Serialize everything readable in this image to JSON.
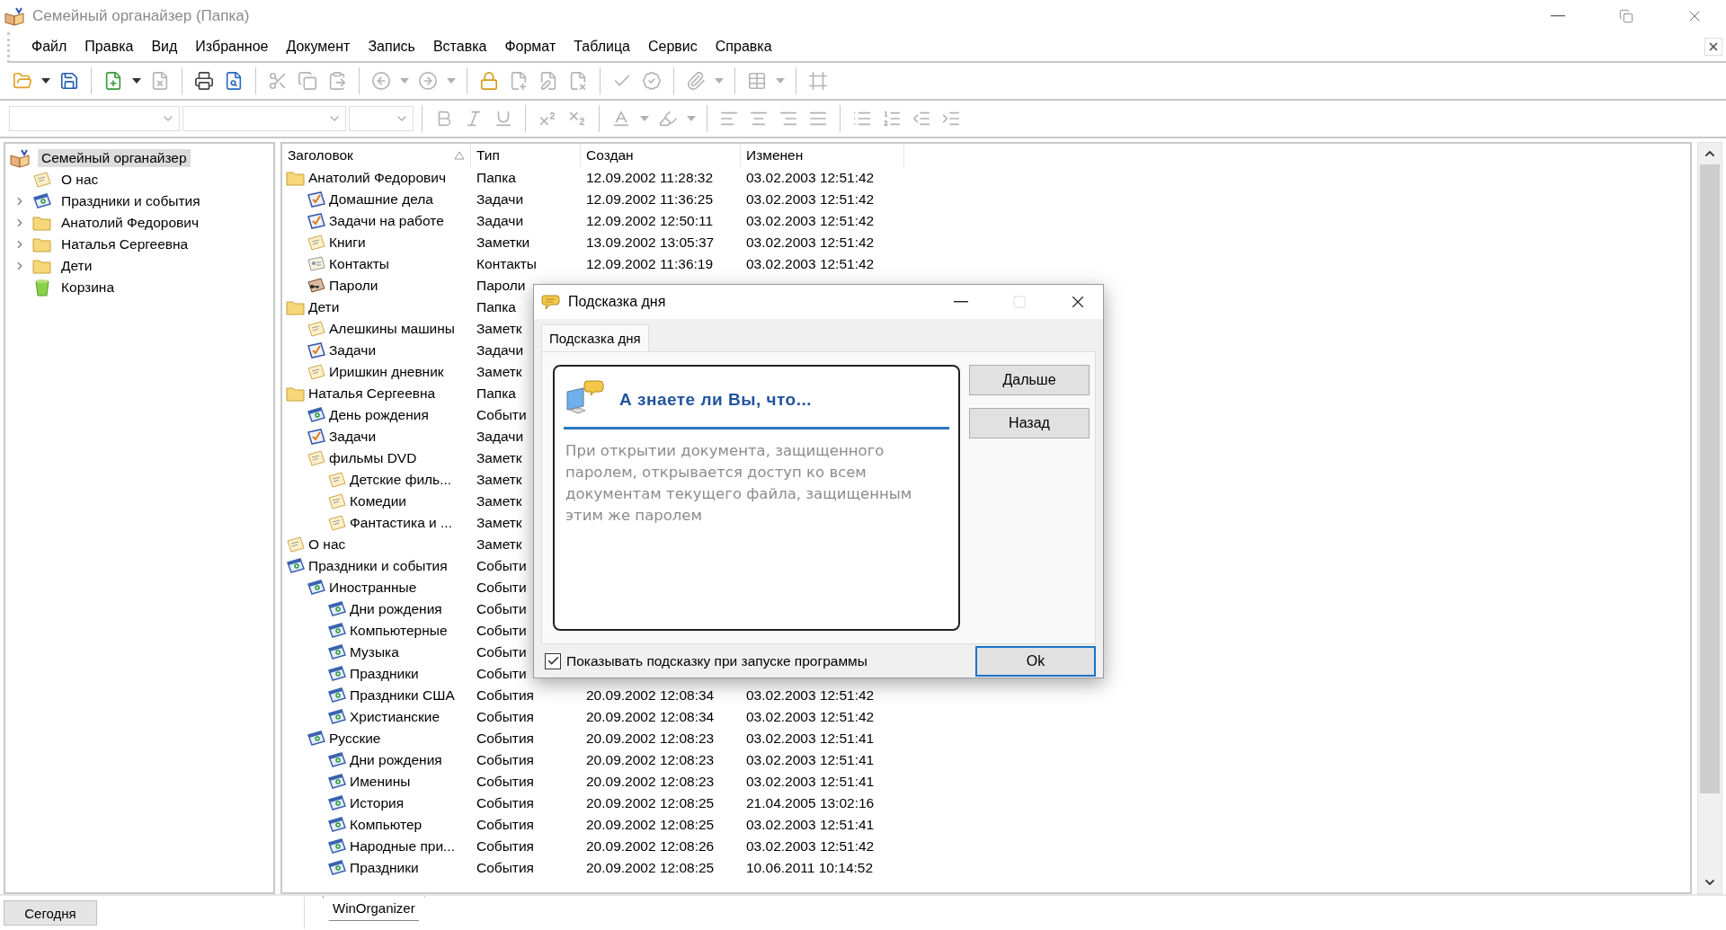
{
  "window": {
    "title": "Семейный органайзер (Папка)"
  },
  "menu": [
    "Файл",
    "Правка",
    "Вид",
    "Избранное",
    "Документ",
    "Запись",
    "Вставка",
    "Формат",
    "Таблица",
    "Сервис",
    "Справка"
  ],
  "toolbar": [
    {
      "kind": "open",
      "disabled": false
    },
    {
      "kind": "dropdown",
      "disabled": false
    },
    {
      "kind": "save",
      "disabled": false
    },
    {
      "kind": "separator"
    },
    {
      "kind": "new",
      "disabled": false
    },
    {
      "kind": "dropdown",
      "disabled": false
    },
    {
      "kind": "delete",
      "disabled": true
    },
    {
      "kind": "separator"
    },
    {
      "kind": "print",
      "disabled": false
    },
    {
      "kind": "preview",
      "disabled": false
    },
    {
      "kind": "separator"
    },
    {
      "kind": "cut",
      "disabled": true
    },
    {
      "kind": "copy",
      "disabled": true
    },
    {
      "kind": "paste",
      "disabled": true
    },
    {
      "kind": "separator"
    },
    {
      "kind": "back",
      "disabled": true
    },
    {
      "kind": "dropdown",
      "disabled": true
    },
    {
      "kind": "forward",
      "disabled": true
    },
    {
      "kind": "dropdown",
      "disabled": true
    },
    {
      "kind": "separator"
    },
    {
      "kind": "lock",
      "disabled": false
    },
    {
      "kind": "newdoc",
      "disabled": true
    },
    {
      "kind": "editdoc",
      "disabled": true
    },
    {
      "kind": "deldoc",
      "disabled": true
    },
    {
      "kind": "separator"
    },
    {
      "kind": "check",
      "disabled": true
    },
    {
      "kind": "approve",
      "disabled": true
    },
    {
      "kind": "separator"
    },
    {
      "kind": "attach",
      "disabled": true
    },
    {
      "kind": "dropdown",
      "disabled": true
    },
    {
      "kind": "separator"
    },
    {
      "kind": "table",
      "disabled": true
    },
    {
      "kind": "dropdown",
      "disabled": true
    },
    {
      "kind": "separator"
    },
    {
      "kind": "frame",
      "disabled": true
    }
  ],
  "format_toolbar": [
    {
      "kind": "combo_wide",
      "disabled": true
    },
    {
      "kind": "combo",
      "disabled": true
    },
    {
      "kind": "combo_narrow",
      "disabled": true
    },
    {
      "kind": "separator"
    },
    {
      "kind": "bold",
      "disabled": true
    },
    {
      "kind": "italic",
      "disabled": true
    },
    {
      "kind": "underline",
      "disabled": true
    },
    {
      "kind": "separator"
    },
    {
      "kind": "superscript",
      "disabled": true
    },
    {
      "kind": "subscript",
      "disabled": true
    },
    {
      "kind": "separator"
    },
    {
      "kind": "fontcolor",
      "disabled": true
    },
    {
      "kind": "dropdown",
      "disabled": true
    },
    {
      "kind": "highlight",
      "disabled": true
    },
    {
      "kind": "dropdown",
      "disabled": true
    },
    {
      "kind": "separator"
    },
    {
      "kind": "alignleft",
      "disabled": true
    },
    {
      "kind": "aligncenter",
      "disabled": true
    },
    {
      "kind": "alignright",
      "disabled": true
    },
    {
      "kind": "justify",
      "disabled": true
    },
    {
      "kind": "separator"
    },
    {
      "kind": "bullets",
      "disabled": true
    },
    {
      "kind": "numbering",
      "disabled": true
    },
    {
      "kind": "outdent",
      "disabled": true
    },
    {
      "kind": "indent",
      "disabled": true
    }
  ],
  "tree": {
    "items": [
      {
        "label": "Семейный органайзер",
        "kind": "organizer",
        "selected": true,
        "children": [
          {
            "label": "О нас",
            "kind": "note",
            "selected": false
          },
          {
            "label": "Праздники и события",
            "kind": "event",
            "selected": false,
            "expanded": false
          },
          {
            "label": "Анатолий Федорович",
            "kind": "folder",
            "selected": false,
            "expanded": false
          },
          {
            "label": "Наталья Сергеевна",
            "kind": "folder",
            "selected": false,
            "expanded": false
          },
          {
            "label": "Дети",
            "kind": "folder",
            "selected": false,
            "expanded": false
          },
          {
            "label": "Корзина",
            "kind": "trash",
            "selected": false
          }
        ]
      }
    ]
  },
  "table": {
    "columns": [
      {
        "label": "Заголовок",
        "sorted": true
      },
      {
        "label": "Тип",
        "sorted": false
      },
      {
        "label": "Создан",
        "sorted": false
      },
      {
        "label": "Изменен",
        "sorted": false
      }
    ],
    "rows": [
      {
        "title": "Анатолий Федорович",
        "kind": "folder",
        "type": "Папка",
        "created": "12.09.2002 11:28:32",
        "modified": "03.02.2003 12:51:42",
        "children": [
          {
            "title": "Домашние дела",
            "kind": "task",
            "type": "Задачи",
            "created": "12.09.2002 11:36:25",
            "modified": "03.02.2003 12:51:42"
          },
          {
            "title": "Задачи на работе",
            "kind": "task",
            "type": "Задачи",
            "created": "12.09.2002 12:50:11",
            "modified": "03.02.2003 12:51:42"
          },
          {
            "title": "Книги",
            "kind": "note",
            "type": "Заметки",
            "created": "13.09.2002 13:05:37",
            "modified": "03.02.2003 12:51:42"
          },
          {
            "title": "Контакты",
            "kind": "contact",
            "type": "Контакты",
            "created": "12.09.2002 11:36:19",
            "modified": "03.02.2003 12:51:42"
          },
          {
            "title": "Пароли",
            "kind": "password",
            "type": "Пароли"
          }
        ]
      },
      {
        "title": "Дети",
        "kind": "folder",
        "type": "Папка",
        "children": [
          {
            "title": "Алешкины машины",
            "kind": "note",
            "type": "Заметк"
          },
          {
            "title": "Задачи",
            "kind": "task",
            "type": "Задачи"
          },
          {
            "title": "Иришкин дневник",
            "kind": "note",
            "type": "Заметк"
          }
        ]
      },
      {
        "title": "Наталья Сергеевна",
        "kind": "folder",
        "type": "Папка",
        "children": [
          {
            "title": "День рождения",
            "kind": "event",
            "type": "Событи"
          },
          {
            "title": "Задачи",
            "kind": "task",
            "type": "Задачи"
          },
          {
            "title": "фильмы DVD",
            "kind": "note",
            "type": "Заметк",
            "children": [
              {
                "title": "Детские филь...",
                "kind": "note",
                "type": "Заметк"
              },
              {
                "title": "Комедии",
                "kind": "note",
                "type": "Заметк"
              },
              {
                "title": "Фантастика и ...",
                "kind": "note",
                "type": "Заметк"
              }
            ]
          }
        ]
      },
      {
        "title": "О нас",
        "kind": "note",
        "type": "Заметк"
      },
      {
        "title": "Праздники и события",
        "kind": "event",
        "type": "Событи",
        "children": [
          {
            "title": "Иностранные",
            "kind": "event",
            "type": "Событи",
            "children": [
              {
                "title": "Дни рождения",
                "kind": "event",
                "type": "Событи"
              },
              {
                "title": "Компьютерные",
                "kind": "event",
                "type": "Событи"
              },
              {
                "title": "Музыка",
                "kind": "event",
                "type": "Событи"
              },
              {
                "title": "Праздники",
                "kind": "event",
                "type": "Событи"
              },
              {
                "title": "Праздники США",
                "kind": "event",
                "type": "События",
                "created": "20.09.2002 12:08:34",
                "modified": "03.02.2003 12:51:42"
              },
              {
                "title": "Христианские",
                "kind": "event",
                "type": "События",
                "created": "20.09.2002 12:08:34",
                "modified": "03.02.2003 12:51:42"
              }
            ]
          },
          {
            "title": "Русские",
            "kind": "event",
            "type": "События",
            "created": "20.09.2002 12:08:23",
            "modified": "03.02.2003 12:51:41",
            "children": [
              {
                "title": "Дни рождения",
                "kind": "event",
                "type": "События",
                "created": "20.09.2002 12:08:23",
                "modified": "03.02.2003 12:51:41"
              },
              {
                "title": "Именины",
                "kind": "event",
                "type": "События",
                "created": "20.09.2002 12:08:23",
                "modified": "03.02.2003 12:51:41"
              },
              {
                "title": "История",
                "kind": "event",
                "type": "События",
                "created": "20.09.2002 12:08:25",
                "modified": "21.04.2005 13:02:16"
              },
              {
                "title": "Компьютер",
                "kind": "event",
                "type": "События",
                "created": "20.09.2002 12:08:25",
                "modified": "03.02.2003 12:51:41"
              },
              {
                "title": "Народные при...",
                "kind": "event",
                "type": "События",
                "created": "20.09.2002 12:08:26",
                "modified": "03.02.2003 12:51:42"
              },
              {
                "title": "Праздники",
                "kind": "event",
                "type": "События",
                "created": "20.09.2002 12:08:25",
                "modified": "10.06.2011 10:14:52"
              }
            ]
          }
        ]
      }
    ]
  },
  "status_bar": {
    "today_button": "Сегодня",
    "tabs": [
      {
        "label": "WinOrganizer",
        "selected": true
      }
    ]
  },
  "dialog": {
    "title": "Подсказка дня",
    "tabs": [
      {
        "label": "Подсказка дня",
        "selected": true
      }
    ],
    "heading": "А знаете ли Вы, что...",
    "text": "При открытии документа, защищенного паролем, открывается доступ ко всем документам текущего файла, защищенным этим же паролем",
    "buttons": [
      "Дальше",
      "Назад"
    ],
    "checkbox": {
      "label": "Показывать подсказку при запуске программы",
      "checked": true
    },
    "ok_button": "Ok"
  }
}
